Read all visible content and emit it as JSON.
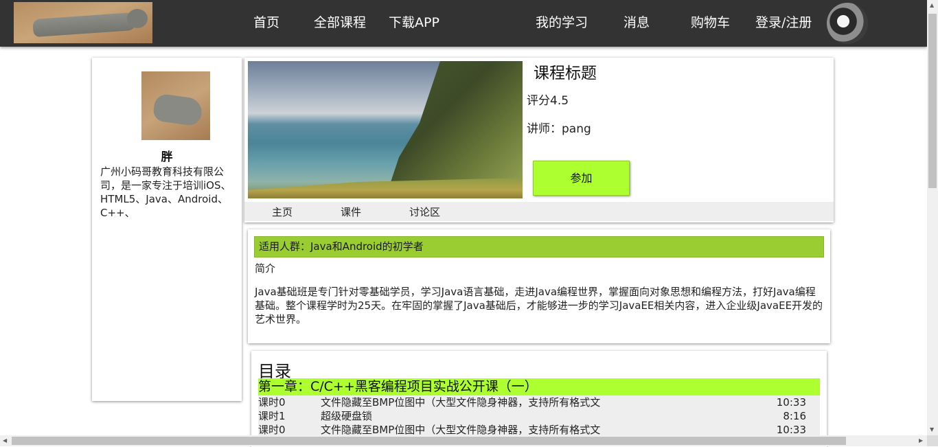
{
  "nav": {
    "links": [
      "首页",
      "全部课程",
      "下载APP"
    ],
    "right_links": [
      "我的学习",
      "消息",
      "购物车",
      "登录/注册"
    ]
  },
  "profile": {
    "name": "胖",
    "description": "广州小码哥教育科技有限公司，是一家专注于培训iOS、HTML5、Java、Android、C++、"
  },
  "course": {
    "title": "课程标题",
    "rating": "评分4.5",
    "teacher": "讲师：pang",
    "join_label": "参加",
    "tabs": [
      "主页",
      "课件",
      "讨论区"
    ]
  },
  "intro": {
    "audience": "适用人群：Java和Android的初学者",
    "label": "简介",
    "text": "Java基础班是专门针对零基础学员，学习Java语言基础，走进Java编程世界，掌握面向对象思想和编程方法，打好Java编程基础。整个课程学时为25天。在牢固的掌握了Java基础后，才能够进一步的学习JavaEE相关内容，进入企业级JavaEE开发的艺术世界。"
  },
  "catalog": {
    "title": "目录",
    "chapter": "第一章：C/C++黑客编程项目实战公开课（一）",
    "lessons": [
      {
        "no": "课时0",
        "name": "文件隐藏至BMP位图中（大型文件隐身神器，支持所有格式文",
        "duration": "10:33"
      },
      {
        "no": "课时1",
        "name": "超级硬盘锁",
        "duration": "8:16"
      },
      {
        "no": "课时0",
        "name": "文件隐藏至BMP位图中（大型文件隐身神器，支持所有格式文",
        "duration": "10:33"
      }
    ]
  },
  "colors": {
    "topbar": "#333333",
    "join_button": "#adff2f",
    "audience_bar": "#9acd32",
    "chapter_bar": "#adff2f"
  }
}
